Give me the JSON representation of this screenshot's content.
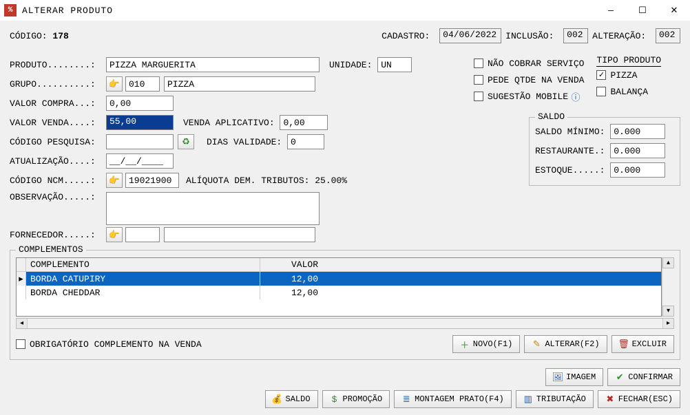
{
  "window": {
    "title": "ALTERAR PRODUTO",
    "minimize": "—",
    "maximize": "☐",
    "close": "✕"
  },
  "header": {
    "codigo_label": "CÓDIGO: ",
    "codigo_value": "178",
    "cadastro_label": "CADASTRO: ",
    "cadastro_value": "04/06/2022",
    "inclusao_label": "INCLUSÃO: ",
    "inclusao_value": "002",
    "alteracao_label": "ALTERAÇÃO: ",
    "alteracao_value": "002"
  },
  "fields": {
    "produto_label": "PRODUTO........:",
    "produto_value": "PIZZA MARGUERITA",
    "unidade_label": "UNIDADE: ",
    "unidade_value": "UN",
    "grupo_label": "GRUPO..........:",
    "grupo_code": "010",
    "grupo_name": "PIZZA",
    "valor_compra_label": "VALOR COMPRA...:",
    "valor_compra_value": "0,00",
    "valor_venda_label": "VALOR VENDA....:",
    "valor_venda_value": "55,00",
    "venda_app_label": "VENDA APLICATIVO: ",
    "venda_app_value": "0,00",
    "codigo_pesquisa_label": "CÓDIGO PESQUISA:",
    "codigo_pesquisa_value": "",
    "dias_validade_label": "DIAS VALIDADE: ",
    "dias_validade_value": "0",
    "atualizacao_label": "ATUALIZAÇÃO....:",
    "atualizacao_value": "__/__/____",
    "ncm_label": "CÓDIGO NCM.....:",
    "ncm_value": "19021900",
    "aliquota_label": "ALÍQUOTA DEM. TRIBUTOS: 25.00%",
    "observacao_label": "OBSERVAÇÃO.....:",
    "observacao_value": "",
    "fornecedor_label": "FORNECEDOR.....:",
    "fornecedor_code": "",
    "fornecedor_name": ""
  },
  "options": {
    "nao_cobrar": "NÃO COBRAR SERVIÇO",
    "pede_qtde": "PEDE QTDE NA VENDA",
    "sugestao_mobile": "SUGESTÃO MOBILE",
    "tipo_produto_title": "TIPO PRODUTO",
    "pizza": "PIZZA",
    "balanca": "BALANÇA",
    "pizza_checked": "✓"
  },
  "saldo": {
    "title": "SALDO",
    "minimo_label": "SALDO MÍNIMO: ",
    "minimo_value": "0.000",
    "restaurante_label": "RESTAURANTE.: ",
    "restaurante_value": "0.000",
    "estoque_label": "ESTOQUE.....: ",
    "estoque_value": "0.000"
  },
  "complements": {
    "title": "COMPLEMENTOS",
    "col_name": "COMPLEMENTO",
    "col_value": "VALOR",
    "rows": [
      {
        "name": "BORDA CATUPIRY",
        "value": "12,00",
        "selected": true
      },
      {
        "name": "BORDA CHEDDAR",
        "value": "12,00",
        "selected": false
      }
    ],
    "obrigatorio_label": "OBRIGATÓRIO COMPLEMENTO NA VENDA"
  },
  "buttons": {
    "novo": "NOVO(F1)",
    "alterar": "ALTERAR(F2)",
    "excluir": "EXCLUIR",
    "imagem": "IMAGEM",
    "confirmar": "CONFIRMAR",
    "saldo": "SALDO",
    "promocao": "PROMOÇÃO",
    "montagem": "MONTAGEM PRATO(F4)",
    "tributacao": "TRIBUTAÇÃO",
    "fechar": "FECHAR(ESC)"
  }
}
